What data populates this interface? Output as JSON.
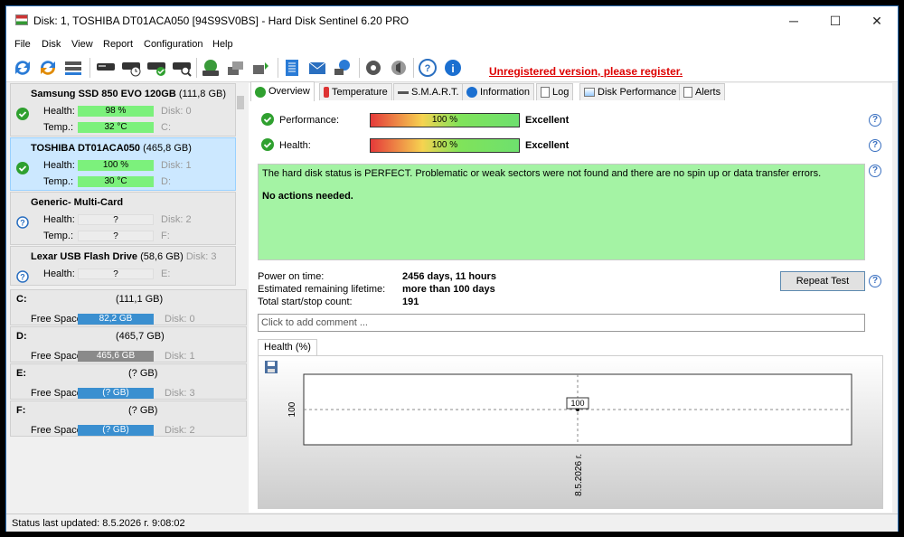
{
  "window": {
    "title": "Disk: 1, TOSHIBA DT01ACA050 [94S9SV0BS]  -  Hard Disk Sentinel 6.20 PRO"
  },
  "menu": [
    "File",
    "Disk",
    "View",
    "Report",
    "Configuration",
    "Help"
  ],
  "toolbar": {
    "register": "Unregistered version, please register."
  },
  "disks": [
    {
      "name": "Samsung SSD 850 EVO 120GB",
      "size": "(111,8 GB)",
      "health": "98 %",
      "temp": "32 °C",
      "disk_label": "Disk: 0",
      "drive": "C:",
      "health_label": "Health:",
      "temp_label": "Temp.:"
    },
    {
      "name": "TOSHIBA DT01ACA050",
      "size": "(465,8 GB)",
      "health": "100 %",
      "temp": "30 °C",
      "disk_label": "Disk: 1",
      "drive": "D:",
      "health_label": "Health:",
      "temp_label": "Temp.:"
    },
    {
      "name": "Generic- Multi-Card",
      "size": "",
      "health": "?",
      "temp": "?",
      "disk_label": "Disk: 2",
      "drive": "F:",
      "health_label": "Health:",
      "temp_label": "Temp.:"
    },
    {
      "name": "Lexar   USB Flash Drive",
      "size": "(58,6 GB)",
      "health": "?",
      "disk_label": "Disk: 3",
      "drive": "E:",
      "health_label": "Health:"
    }
  ],
  "volumes": [
    {
      "letter": "C:",
      "size": "(111,1 GB)",
      "free_label": "Free Space",
      "free": "82,2 GB",
      "disk": "Disk: 0",
      "color": "#3a8fd0"
    },
    {
      "letter": "D:",
      "size": "(465,7 GB)",
      "free_label": "Free Space",
      "free": "465,6 GB",
      "disk": "Disk: 1",
      "color": "#8a8a8a"
    },
    {
      "letter": "E:",
      "size": "(? GB)",
      "free_label": "Free Space",
      "free": "(? GB)",
      "disk": "Disk: 3",
      "color": "#3a8fd0"
    },
    {
      "letter": "F:",
      "size": "(? GB)",
      "free_label": "Free Space",
      "free": "(? GB)",
      "disk": "Disk: 2",
      "color": "#3a8fd0"
    }
  ],
  "status": "Status last updated: 8.5.2026 г. 9:08:02",
  "tabs": [
    "Overview",
    "Temperature",
    "S.M.A.R.T.",
    "Information",
    "Log",
    "Disk Performance",
    "Alerts"
  ],
  "overview": {
    "performance_label": "Performance:",
    "performance": "100 %",
    "performance_verdict": "Excellent",
    "health_label": "Health:",
    "health": "100 %",
    "health_verdict": "Excellent",
    "message": "The hard disk status is PERFECT. Problematic or weak sectors were not found and there are no spin up or data transfer errors.",
    "action": "No actions needed.",
    "power_on_label": "Power on time:",
    "power_on": "2456 days, 11 hours",
    "lifetime_label": "Estimated remaining lifetime:",
    "lifetime": "more than 100 days",
    "startstop_label": "Total start/stop count:",
    "startstop": "191",
    "repeat_test": "Repeat Test",
    "comment_placeholder": "Click to add comment ...",
    "health_tab": "Health (%)"
  },
  "chart_data": {
    "type": "line",
    "title": "",
    "series": [
      {
        "values": [
          100
        ]
      }
    ],
    "x": [
      "8.5.2026 г."
    ],
    "point_label": "100",
    "ytick": "100"
  }
}
